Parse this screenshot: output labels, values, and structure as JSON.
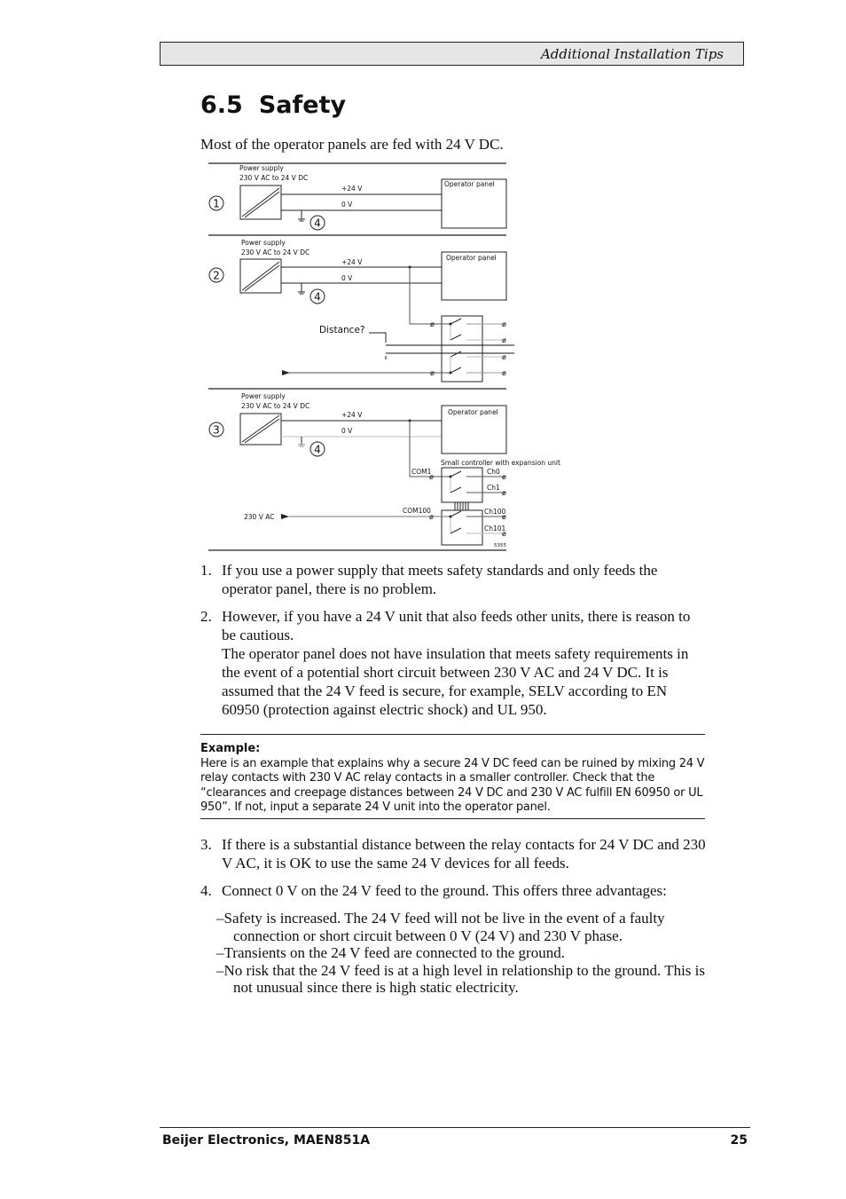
{
  "header": {
    "title": "Additional Installation Tips"
  },
  "section": {
    "number": "6.5",
    "title": "Safety"
  },
  "intro": "Most of the operator panels are fed with 24 V DC.",
  "diagram": {
    "power_supply_label": "Power supply",
    "power_supply_spec": "230 V AC to 24 V DC",
    "plus24": "+24 V",
    "zero_v": "0 V",
    "operator_panel": "Operator panel",
    "markers": [
      "1",
      "2",
      "3",
      "4"
    ],
    "distance": "Distance?",
    "controller_label": "Small controller with expansion unit",
    "com1": "COM1",
    "com100": "COM100",
    "ch0": "Ch0",
    "ch1": "Ch1",
    "ch100": "Ch100",
    "ch101": "Ch101",
    "ac230": "230 V AC",
    "figure_id": "5355"
  },
  "list": [
    {
      "n": "1.",
      "text": "If you use a power supply that meets safety standards and only feeds the operator panel, there is no problem."
    },
    {
      "n": "2.",
      "text": "However, if you have a 24 V unit that also feeds other units, there is reason to be cautious.",
      "extra": "The operator panel does not have insulation that meets safety requirements in the event of a potential short circuit between 230 V AC and 24 V DC. It is assumed that the 24 V feed is secure, for example, SELV according to EN 60950 (protection against electric shock) and UL 950."
    },
    {
      "n": "3.",
      "text": "If there is a substantial distance between the relay contacts for 24 V DC and 230 V AC, it is OK to use the same 24 V devices for all feeds."
    },
    {
      "n": "4.",
      "text": "Connect 0 V on the 24 V feed to the ground. This offers three advantages:"
    }
  ],
  "example": {
    "heading": "Example:",
    "body": "Here is an example that explains why a secure 24 V DC feed can be ruined by mixing 24 V relay contacts with 230 V AC relay contacts in a smaller controller. Check that the “clearances and creepage distances between 24 V DC and 230 V AC fulfill EN 60950 or UL 950”. If not, input a separate 24 V unit into the operator panel."
  },
  "advantages": [
    "–Safety is increased. The 24 V feed will not be live in the event of a faulty connection or short circuit between 0 V (24 V) and 230 V phase.",
    "–Transients on the 24 V feed are connected to the ground.",
    "–No risk that the 24 V feed is at a high level in relationship to the ground. This is not unusual since there is high static electricity."
  ],
  "footer": {
    "left": "Beijer Electronics, MAEN851A",
    "page": "25"
  }
}
